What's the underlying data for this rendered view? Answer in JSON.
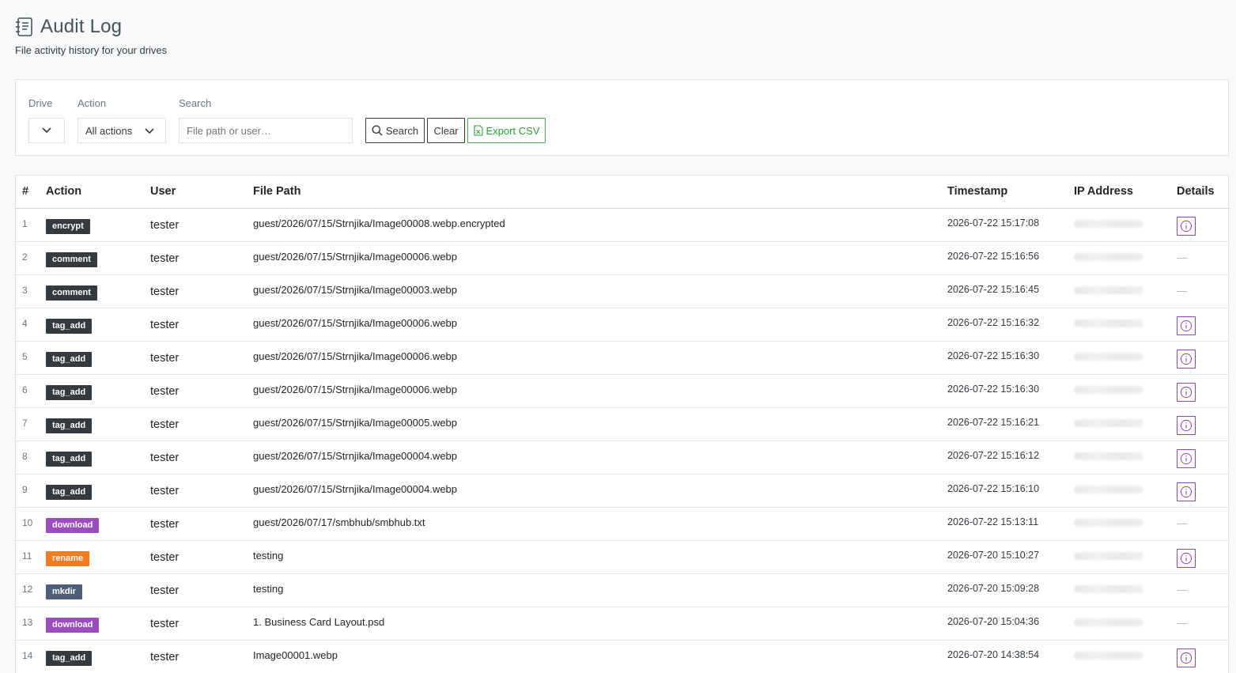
{
  "header": {
    "icon": "journal-text-icon",
    "title": "Audit Log",
    "subtitle": "File activity history for your drives"
  },
  "filters": {
    "drive_label": "Drive",
    "drive_value": "",
    "action_label": "Action",
    "action_value": "All actions",
    "search_label": "Search",
    "search_placeholder": "File path or user…",
    "search_button": "Search",
    "clear_button": "Clear",
    "export_button": "Export CSV"
  },
  "table": {
    "columns": [
      "#",
      "Action",
      "User",
      "File Path",
      "Timestamp",
      "IP Address",
      "Details"
    ],
    "rows": [
      {
        "n": "1",
        "action": "encrypt",
        "color": "#343a40",
        "user": "tester",
        "path": "guest/2026/07/15/Strnjika/Image00008.webp.encrypted",
        "ts": "2026-07-22 15:17:08",
        "details": true
      },
      {
        "n": "2",
        "action": "comment",
        "color": "#343a40",
        "user": "tester",
        "path": "guest/2026/07/15/Strnjika/Image00006.webp",
        "ts": "2026-07-22 15:16:56",
        "details": false
      },
      {
        "n": "3",
        "action": "comment",
        "color": "#343a40",
        "user": "tester",
        "path": "guest/2026/07/15/Strnjika/Image00003.webp",
        "ts": "2026-07-22 15:16:45",
        "details": false
      },
      {
        "n": "4",
        "action": "tag_add",
        "color": "#343a40",
        "user": "tester",
        "path": "guest/2026/07/15/Strnjika/Image00006.webp",
        "ts": "2026-07-22 15:16:32",
        "details": true
      },
      {
        "n": "5",
        "action": "tag_add",
        "color": "#343a40",
        "user": "tester",
        "path": "guest/2026/07/15/Strnjika/Image00006.webp",
        "ts": "2026-07-22 15:16:30",
        "details": true
      },
      {
        "n": "6",
        "action": "tag_add",
        "color": "#343a40",
        "user": "tester",
        "path": "guest/2026/07/15/Strnjika/Image00006.webp",
        "ts": "2026-07-22 15:16:30",
        "details": true
      },
      {
        "n": "7",
        "action": "tag_add",
        "color": "#343a40",
        "user": "tester",
        "path": "guest/2026/07/15/Strnjika/Image00005.webp",
        "ts": "2026-07-22 15:16:21",
        "details": true
      },
      {
        "n": "8",
        "action": "tag_add",
        "color": "#343a40",
        "user": "tester",
        "path": "guest/2026/07/15/Strnjika/Image00004.webp",
        "ts": "2026-07-22 15:16:12",
        "details": true
      },
      {
        "n": "9",
        "action": "tag_add",
        "color": "#343a40",
        "user": "tester",
        "path": "guest/2026/07/15/Strnjika/Image00004.webp",
        "ts": "2026-07-22 15:16:10",
        "details": true
      },
      {
        "n": "10",
        "action": "download",
        "color": "#9b4dc0",
        "user": "tester",
        "path": "guest/2026/07/17/smbhub/smbhub.txt",
        "ts": "2026-07-22 15:13:11",
        "details": false
      },
      {
        "n": "11",
        "action": "rename",
        "color": "#f47c20",
        "user": "tester",
        "path": "testing",
        "ts": "2026-07-20 15:10:27",
        "details": true
      },
      {
        "n": "12",
        "action": "mkdir",
        "color": "#4e5d78",
        "user": "tester",
        "path": "testing",
        "ts": "2026-07-20 15:09:28",
        "details": false
      },
      {
        "n": "13",
        "action": "download",
        "color": "#9b4dc0",
        "user": "tester",
        "path": "1. Business Card Layout.psd",
        "ts": "2026-07-20 15:04:36",
        "details": false
      },
      {
        "n": "14",
        "action": "tag_add",
        "color": "#343a40",
        "user": "tester",
        "path": "Image00001.webp",
        "ts": "2026-07-20 14:38:54",
        "details": true
      }
    ]
  },
  "colors": {
    "accent_success": "#4caf50",
    "details_icon": "#8e44ad"
  }
}
